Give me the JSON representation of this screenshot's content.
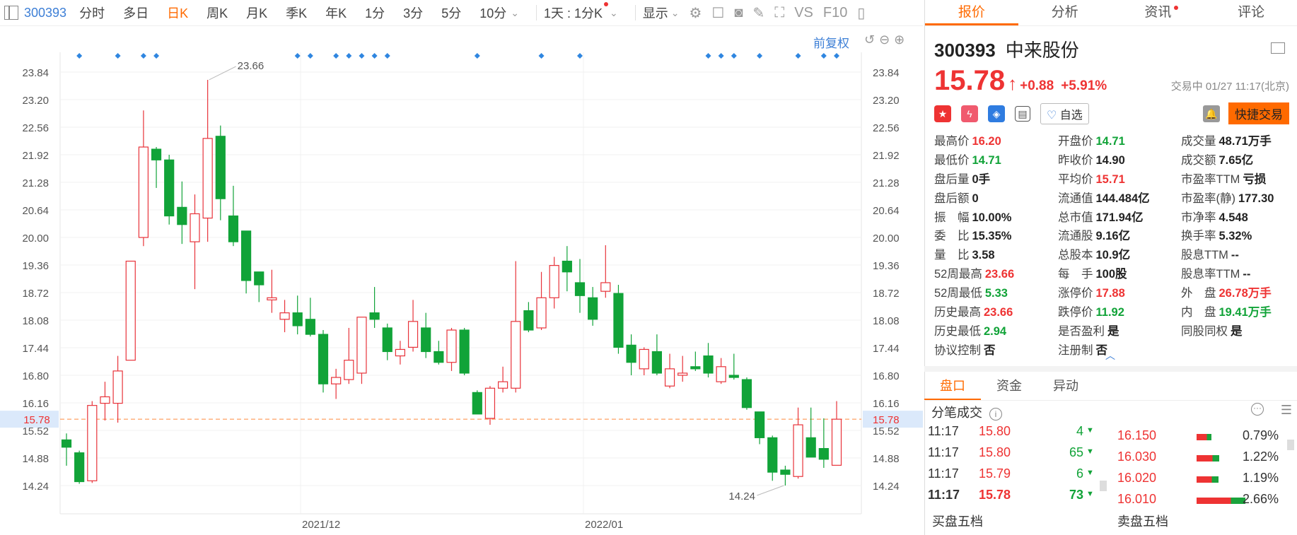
{
  "topbar": {
    "code": "300393",
    "tabs": [
      "分时",
      "多日",
      "日K",
      "周K",
      "月K",
      "季K",
      "年K",
      "1分",
      "3分",
      "5分",
      "10分"
    ],
    "active_tab": "日K",
    "period_select": "1天 : 1分K",
    "display_label": "显示",
    "tools": [
      "VS",
      "F10"
    ]
  },
  "chart": {
    "adjust_label": "前复权",
    "dates": [
      "2021/12",
      "2022/01"
    ],
    "current_price_label": "15.78",
    "high_annotation": "23.66",
    "low_annotation": "14.24"
  },
  "chart_data": {
    "type": "candlestick",
    "title": "",
    "y_ticks": [
      "23.84",
      "23.20",
      "22.56",
      "21.92",
      "21.28",
      "20.64",
      "20.00",
      "19.36",
      "18.72",
      "18.08",
      "17.44",
      "16.80",
      "16.16",
      "15.52",
      "14.88",
      "14.24"
    ],
    "ylim": [
      13.7,
      24.3
    ],
    "x_labels": [
      "2021/12",
      "2022/01"
    ],
    "reference_line": 15.78,
    "markers": [
      1,
      4,
      6,
      7,
      18,
      19,
      21,
      22,
      23,
      24,
      25,
      32,
      37,
      40,
      50,
      51,
      52,
      54,
      57,
      59,
      60
    ],
    "candles": [
      {
        "o": 15.3,
        "c": 15.13,
        "h": 15.45,
        "l": 14.7
      },
      {
        "o": 15.0,
        "c": 14.33,
        "h": 15.05,
        "l": 14.28
      },
      {
        "o": 14.35,
        "c": 16.1,
        "h": 16.2,
        "l": 14.3
      },
      {
        "o": 16.15,
        "c": 16.3,
        "h": 16.65,
        "l": 15.75
      },
      {
        "o": 16.15,
        "c": 16.9,
        "h": 17.25,
        "l": 15.7
      },
      {
        "o": 17.15,
        "c": 19.45,
        "h": 19.45,
        "l": 17.15
      },
      {
        "o": 20.0,
        "c": 22.1,
        "h": 22.95,
        "l": 19.8
      },
      {
        "o": 22.05,
        "c": 21.8,
        "h": 22.1,
        "l": 21.15
      },
      {
        "o": 21.8,
        "c": 20.5,
        "h": 21.92,
        "l": 20.3
      },
      {
        "o": 20.7,
        "c": 20.3,
        "h": 21.3,
        "l": 19.85
      },
      {
        "o": 19.9,
        "c": 20.55,
        "h": 21.0,
        "l": 18.8
      },
      {
        "o": 20.45,
        "c": 22.3,
        "h": 23.66,
        "l": 19.9
      },
      {
        "o": 22.35,
        "c": 20.9,
        "h": 22.6,
        "l": 20.4
      },
      {
        "o": 20.5,
        "c": 19.9,
        "h": 21.2,
        "l": 19.8
      },
      {
        "o": 20.15,
        "c": 19.0,
        "h": 20.15,
        "l": 18.7
      },
      {
        "o": 19.2,
        "c": 18.9,
        "h": 19.2,
        "l": 18.5
      },
      {
        "o": 18.55,
        "c": 18.6,
        "h": 19.25,
        "l": 18.25
      },
      {
        "o": 18.1,
        "c": 18.25,
        "h": 18.55,
        "l": 17.8
      },
      {
        "o": 18.25,
        "c": 17.95,
        "h": 18.65,
        "l": 17.75
      },
      {
        "o": 18.1,
        "c": 17.75,
        "h": 18.6,
        "l": 17.7
      },
      {
        "o": 17.75,
        "c": 16.6,
        "h": 17.85,
        "l": 16.4
      },
      {
        "o": 16.6,
        "c": 16.75,
        "h": 16.95,
        "l": 16.25
      },
      {
        "o": 16.7,
        "c": 17.15,
        "h": 17.9,
        "l": 16.6
      },
      {
        "o": 16.85,
        "c": 18.15,
        "h": 18.15,
        "l": 16.6
      },
      {
        "o": 18.25,
        "c": 18.1,
        "h": 18.85,
        "l": 17.9
      },
      {
        "o": 17.9,
        "c": 17.35,
        "h": 18.0,
        "l": 17.15
      },
      {
        "o": 17.25,
        "c": 17.4,
        "h": 17.6,
        "l": 17.05
      },
      {
        "o": 17.45,
        "c": 18.05,
        "h": 18.55,
        "l": 17.35
      },
      {
        "o": 17.9,
        "c": 17.35,
        "h": 18.25,
        "l": 17.2
      },
      {
        "o": 17.35,
        "c": 17.1,
        "h": 17.6,
        "l": 17.05
      },
      {
        "o": 17.1,
        "c": 17.85,
        "h": 17.9,
        "l": 16.9
      },
      {
        "o": 17.85,
        "c": 16.85,
        "h": 17.9,
        "l": 16.8
      },
      {
        "o": 16.4,
        "c": 15.9,
        "h": 16.45,
        "l": 15.9
      },
      {
        "o": 15.8,
        "c": 16.5,
        "h": 16.55,
        "l": 15.65
      },
      {
        "o": 16.5,
        "c": 16.65,
        "h": 17.0,
        "l": 16.4
      },
      {
        "o": 16.5,
        "c": 18.05,
        "h": 19.45,
        "l": 16.4
      },
      {
        "o": 18.3,
        "c": 17.85,
        "h": 18.5,
        "l": 17.8
      },
      {
        "o": 17.9,
        "c": 18.6,
        "h": 19.2,
        "l": 17.85
      },
      {
        "o": 18.6,
        "c": 19.35,
        "h": 19.55,
        "l": 18.35
      },
      {
        "o": 19.45,
        "c": 19.2,
        "h": 19.8,
        "l": 18.75
      },
      {
        "o": 18.95,
        "c": 18.65,
        "h": 19.5,
        "l": 18.25
      },
      {
        "o": 18.6,
        "c": 18.1,
        "h": 18.85,
        "l": 17.95
      },
      {
        "o": 18.75,
        "c": 18.95,
        "h": 19.82,
        "l": 18.6
      },
      {
        "o": 18.7,
        "c": 17.45,
        "h": 18.9,
        "l": 17.3
      },
      {
        "o": 17.5,
        "c": 17.1,
        "h": 17.75,
        "l": 16.8
      },
      {
        "o": 16.95,
        "c": 17.4,
        "h": 17.45,
        "l": 16.8
      },
      {
        "o": 17.35,
        "c": 16.85,
        "h": 17.75,
        "l": 16.8
      },
      {
        "o": 16.55,
        "c": 16.95,
        "h": 17.3,
        "l": 16.5
      },
      {
        "o": 16.8,
        "c": 16.85,
        "h": 17.25,
        "l": 16.65
      },
      {
        "o": 17.0,
        "c": 16.95,
        "h": 17.35,
        "l": 16.9
      },
      {
        "o": 17.25,
        "c": 16.85,
        "h": 17.55,
        "l": 16.75
      },
      {
        "o": 16.65,
        "c": 17.0,
        "h": 17.2,
        "l": 16.6
      },
      {
        "o": 16.8,
        "c": 16.75,
        "h": 17.3,
        "l": 16.7
      },
      {
        "o": 16.7,
        "c": 16.05,
        "h": 16.75,
        "l": 16.0
      },
      {
        "o": 15.95,
        "c": 15.35,
        "h": 15.95,
        "l": 15.2
      },
      {
        "o": 15.35,
        "c": 14.55,
        "h": 15.4,
        "l": 14.35
      },
      {
        "o": 14.6,
        "c": 14.5,
        "h": 14.7,
        "l": 14.24
      },
      {
        "o": 14.45,
        "c": 15.65,
        "h": 16.05,
        "l": 14.4
      },
      {
        "o": 15.35,
        "c": 14.9,
        "h": 16.05,
        "l": 14.9
      },
      {
        "o": 15.1,
        "c": 14.85,
        "h": 15.8,
        "l": 14.65
      },
      {
        "o": 14.71,
        "c": 15.78,
        "h": 16.2,
        "l": 14.71
      }
    ]
  },
  "tabs": [
    "报价",
    "分析",
    "资讯",
    "评论"
  ],
  "stock": {
    "code": "300393",
    "name": "中来股份",
    "price": "15.78",
    "arrow": "↑",
    "change": "+0.88",
    "change_pct": "+5.91%",
    "timestamp": "交易中 01/27 11:17(北京)",
    "watch_label": "自选",
    "quick_trade": "快捷交易"
  },
  "stats": [
    [
      {
        "l": "最高价",
        "v": "16.20",
        "c": "r"
      },
      {
        "l": "开盘价",
        "v": "14.71",
        "c": "g"
      },
      {
        "l": "成交量",
        "v": "48.71万手",
        "c": ""
      }
    ],
    [
      {
        "l": "最低价",
        "v": "14.71",
        "c": "g"
      },
      {
        "l": "昨收价",
        "v": "14.90",
        "c": ""
      },
      {
        "l": "成交额",
        "v": "7.65亿",
        "c": ""
      }
    ],
    [
      {
        "l": "盘后量",
        "v": "0手",
        "c": ""
      },
      {
        "l": "平均价",
        "v": "15.71",
        "c": "r"
      },
      {
        "l": "市盈率TTM",
        "v": "亏损",
        "c": ""
      }
    ],
    [
      {
        "l": "盘后额",
        "v": "0",
        "c": ""
      },
      {
        "l": "流通值",
        "v": "144.484亿",
        "c": ""
      },
      {
        "l": "市盈率(静)",
        "v": "177.30",
        "c": ""
      }
    ],
    [
      {
        "l": "振　幅",
        "v": "10.00%",
        "c": ""
      },
      {
        "l": "总市值",
        "v": "171.94亿",
        "c": ""
      },
      {
        "l": "市净率",
        "v": "4.548",
        "c": ""
      }
    ],
    [
      {
        "l": "委　比",
        "v": "15.35%",
        "c": ""
      },
      {
        "l": "流通股",
        "v": "9.16亿",
        "c": ""
      },
      {
        "l": "换手率",
        "v": "5.32%",
        "c": ""
      }
    ],
    [
      {
        "l": "量　比",
        "v": "3.58",
        "c": ""
      },
      {
        "l": "总股本",
        "v": "10.9亿",
        "c": ""
      },
      {
        "l": "股息TTM",
        "v": "--",
        "c": ""
      }
    ],
    [
      {
        "l": "52周最高",
        "v": "23.66",
        "c": "r"
      },
      {
        "l": "每　手",
        "v": "100股",
        "c": ""
      },
      {
        "l": "股息率TTM",
        "v": "--",
        "c": ""
      }
    ],
    [
      {
        "l": "52周最低",
        "v": "5.33",
        "c": "g"
      },
      {
        "l": "涨停价",
        "v": "17.88",
        "c": "r"
      },
      {
        "l": "外　盘",
        "v": "26.78万手",
        "c": "r"
      }
    ],
    [
      {
        "l": "历史最高",
        "v": "23.66",
        "c": "r"
      },
      {
        "l": "跌停价",
        "v": "11.92",
        "c": "g"
      },
      {
        "l": "内　盘",
        "v": "19.41万手",
        "c": "g"
      }
    ],
    [
      {
        "l": "历史最低",
        "v": "2.94",
        "c": "g"
      },
      {
        "l": "是否盈利",
        "v": "是",
        "c": ""
      },
      {
        "l": "同股同权",
        "v": "是",
        "c": ""
      }
    ],
    [
      {
        "l": "协议控制",
        "v": "否",
        "c": ""
      },
      {
        "l": "注册制",
        "v": "否",
        "c": ""
      },
      {
        "l": "",
        "v": "",
        "c": ""
      }
    ]
  ],
  "subtabs": [
    "盘口",
    "资金",
    "异动"
  ],
  "trades_title": "分笔成交",
  "trades": [
    {
      "t": "11:17",
      "p": "15.80",
      "q": "4"
    },
    {
      "t": "11:17",
      "p": "15.80",
      "q": "65"
    },
    {
      "t": "11:17",
      "p": "15.79",
      "q": "6"
    },
    {
      "t": "11:17",
      "p": "15.78",
      "q": "73"
    }
  ],
  "asks": [
    {
      "p": "16.150",
      "pct": "0.79%",
      "r": 0.79
    },
    {
      "p": "16.030",
      "pct": "1.22%",
      "r": 1.22
    },
    {
      "p": "16.020",
      "pct": "1.19%",
      "r": 1.19
    },
    {
      "p": "16.010",
      "pct": "2.66%",
      "r": 2.66
    }
  ],
  "five_levels": {
    "buy": "买盘五档",
    "sell": "卖盘五档"
  }
}
